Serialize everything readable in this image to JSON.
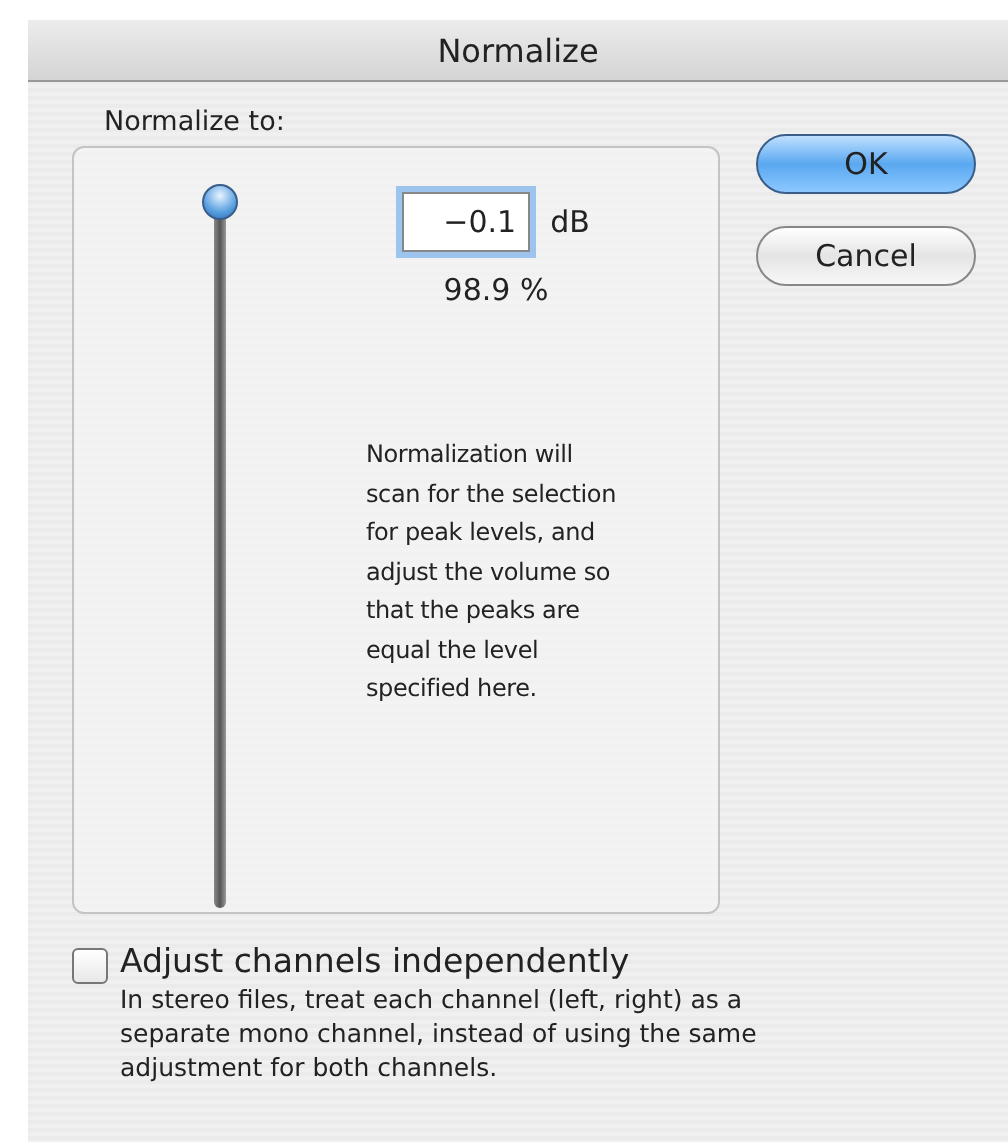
{
  "window": {
    "title": "Normalize"
  },
  "group": {
    "label": "Normalize to:"
  },
  "slider": {
    "level": 1
  },
  "value_field": {
    "value": "−0.1",
    "unit": "dB"
  },
  "percent": "98.9 %",
  "description": "Normalization will scan for the selection for peak levels, and adjust the volume so that the peaks are equal the level specified here.",
  "buttons": [
    {
      "label": "OK",
      "kind": "default"
    },
    {
      "label": "Cancel",
      "kind": "normal"
    }
  ],
  "option": {
    "label": "Adjust channels independently",
    "checked": false,
    "description": "In stereo files, treat each channel (left, right) as a separate mono channel, instead of using the same adjustment for both channels."
  }
}
